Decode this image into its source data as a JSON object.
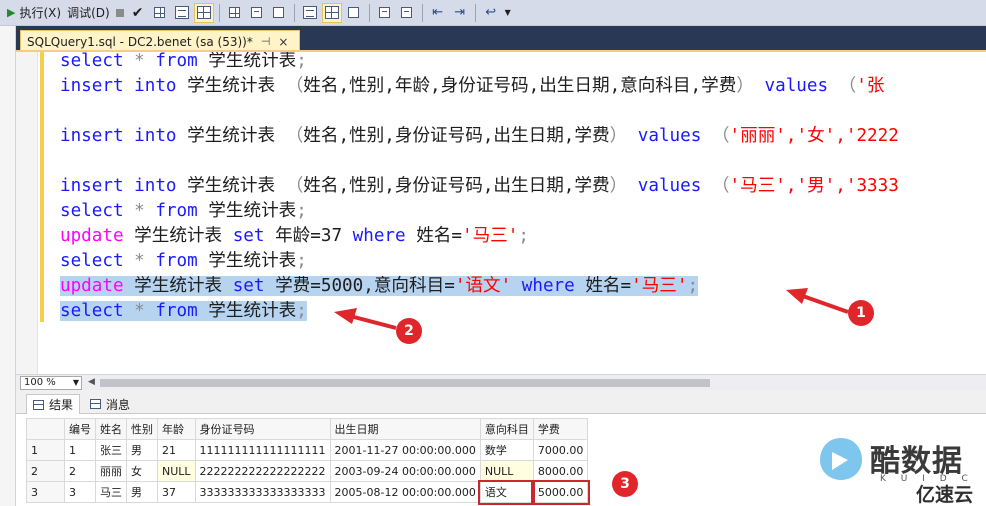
{
  "toolbar": {
    "execute_label": "执行(X)",
    "debug_label": "调试(D)"
  },
  "tab": {
    "title": "SQLQuery1.sql - DC2.benet (sa (53))*",
    "pin": "⊣",
    "close": "×"
  },
  "editor": {
    "lines": [
      {
        "kind": "select",
        "kw1": "select",
        "star": "*",
        "kw2": "from",
        "tbl": "学生统计表",
        "end": ";"
      },
      {
        "kind": "insert",
        "kw1": "insert",
        "kw2": "into",
        "tbl": "学生统计表",
        "cols": "（姓名,性别,年龄,身份证号码,出生日期,意向科目,学费）",
        "kw3": "values",
        "vals": "（'张"
      },
      {
        "kind": "blank"
      },
      {
        "kind": "insert",
        "kw1": "insert",
        "kw2": "into",
        "tbl": "学生统计表",
        "cols": "（姓名,性别,身份证号码,出生日期,学费）",
        "kw3": "values",
        "vals": "（'丽丽','女','2222"
      },
      {
        "kind": "blank"
      },
      {
        "kind": "insert",
        "kw1": "insert",
        "kw2": "into",
        "tbl": "学生统计表",
        "cols": "（姓名,性别,身份证号码,出生日期,学费）",
        "kw3": "values",
        "vals": "（'马三','男','3333"
      },
      {
        "kind": "select",
        "kw1": "select",
        "star": "*",
        "kw2": "from",
        "tbl": "学生统计表",
        "end": ";"
      },
      {
        "kind": "update1",
        "kw1": "update",
        "tbl": "学生统计表",
        "kw2": "set",
        "assign": "年龄=37",
        "kw3": "where",
        "cond": "姓名=",
        "val": "'马三'",
        "end": ";"
      },
      {
        "kind": "select",
        "kw1": "select",
        "star": "*",
        "kw2": "from",
        "tbl": "学生统计表",
        "end": ";"
      },
      {
        "kind": "update2",
        "kw1": "update",
        "tbl": "学生统计表",
        "kw2": "set",
        "assign": "学费=5000,意向科目=",
        "val1": "'语文'",
        "kw3": "where",
        "cond": "姓名=",
        "val2": "'马三'",
        "end": ";",
        "selected": true
      },
      {
        "kind": "select",
        "kw1": "select",
        "star": "*",
        "kw2": "from",
        "tbl": "学生统计表",
        "end": ";",
        "selected": true
      }
    ]
  },
  "status": {
    "zoom": "100 %"
  },
  "result_tabs": {
    "results": "结果",
    "messages": "消息"
  },
  "grid": {
    "headers": [
      "编号",
      "姓名",
      "性别",
      "年龄",
      "身份证号码",
      "出生日期",
      "意向科目",
      "学费"
    ],
    "rows": [
      {
        "rownum": "1",
        "cells": [
          "1",
          "张三",
          "男",
          "21",
          "111111111111111111",
          "2001-11-27 00:00:00.000",
          "数学",
          "7000.00"
        ]
      },
      {
        "rownum": "2",
        "cells": [
          "2",
          "丽丽",
          "女",
          "NULL",
          "222222222222222222",
          "2003-09-24 00:00:00.000",
          "NULL",
          "8000.00"
        ]
      },
      {
        "rownum": "3",
        "cells": [
          "3",
          "马三",
          "男",
          "37",
          "333333333333333333",
          "2005-08-12 00:00:00.000",
          "语文",
          "5000.00"
        ]
      }
    ]
  },
  "annotations": {
    "badge1": "1",
    "badge2": "2",
    "badge3": "3"
  },
  "watermark": {
    "main": "酷数据",
    "sub": "K U I D C",
    "brand": "亿速云"
  },
  "colors": {
    "keyword": "#1a1aff",
    "update_keyword": "#ff00ff",
    "string": "#ff0000",
    "selection": "#b6d4ef",
    "annotation": "#e0262b"
  }
}
